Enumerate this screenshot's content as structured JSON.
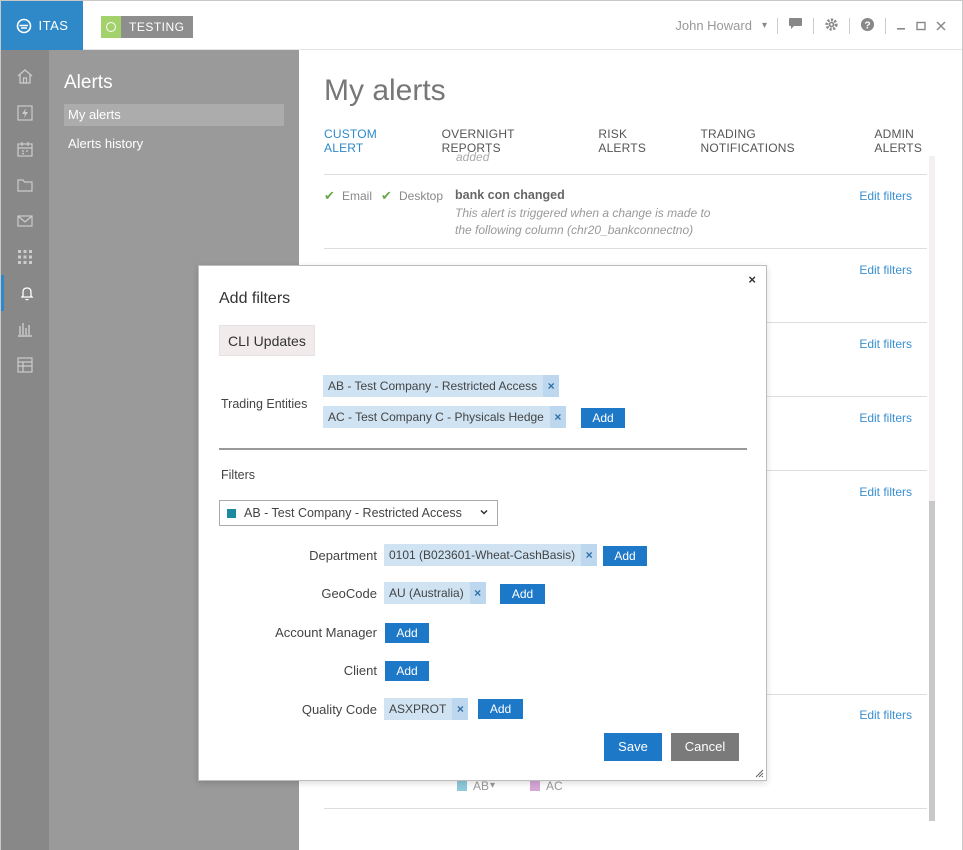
{
  "titlebar": {
    "logo_text": "ITAS",
    "env_badge": "TESTING",
    "user_name": "John Howard",
    "user_caret": "▾",
    "icons": [
      "chat-icon",
      "gear-icon",
      "help-icon",
      "minimize-icon",
      "maximize-icon",
      "close-icon"
    ]
  },
  "iconbar": {
    "items": [
      "home-icon",
      "lightning-icon",
      "calendar-icon",
      "folder-icon",
      "mail-icon",
      "grid-icon",
      "bell-icon",
      "bar-chart-icon",
      "table-icon"
    ],
    "active": "bell-icon"
  },
  "sidebar": {
    "title": "Alerts",
    "items": [
      {
        "label": "My alerts",
        "selected": true
      },
      {
        "label": "Alerts history",
        "selected": false
      }
    ]
  },
  "main": {
    "title": "My alerts",
    "tabs": [
      {
        "label": "CUSTOM ALERT",
        "active": true
      },
      {
        "label": "OVERNIGHT REPORTS",
        "active": false
      },
      {
        "label": "RISK ALERTS",
        "active": false
      },
      {
        "label": "TRADING NOTIFICATIONS",
        "active": false
      },
      {
        "label": "ADMIN ALERTS",
        "active": false
      }
    ],
    "clipped_text": "added",
    "alert": {
      "email_label": "Email",
      "desktop_label": "Desktop",
      "name": "bank con changed",
      "description_line1": "This alert is triggered when a change is made to",
      "description_line2": "the following column  (chr20_bankconnectno)"
    },
    "edit_filters_label": "Edit filters",
    "legend": [
      {
        "label": "AB",
        "color": "#8ec9dc",
        "caret": "▾"
      },
      {
        "label": "AC",
        "color": "#d6a6d6"
      }
    ]
  },
  "dialog": {
    "title": "Add filters",
    "close_symbol": "×",
    "group_label": "CLI Updates",
    "trading_entities_label": "Trading Entities",
    "trading_entities": [
      "AB - Test Company - Restricted Access",
      "AC - Test Company C - Physicals Hedge"
    ],
    "filters_label": "Filters",
    "selected_entity": "AB - Test Company - Restricted Access",
    "remove_symbol": "×",
    "add_label": "Add",
    "fields": {
      "department": {
        "label": "Department",
        "chips": [
          "0101 (B023601-Wheat-CashBasis)"
        ]
      },
      "geocode": {
        "label": "GeoCode",
        "chips": [
          "AU  (Australia)"
        ]
      },
      "account_manager": {
        "label": "Account Manager",
        "chips": []
      },
      "client": {
        "label": "Client",
        "chips": []
      },
      "quality_code": {
        "label": "Quality Code",
        "chips": [
          "ASXPROT"
        ]
      }
    },
    "save_label": "Save",
    "cancel_label": "Cancel"
  },
  "colors": {
    "accent": "#2f89c9",
    "button_blue": "#1e78c8",
    "chip_bg": "#cfe3f3",
    "sidebar_bg": "#9a9a9a",
    "iconbar_bg": "#888888",
    "env_badge_green": "#a3d16c",
    "check_green": "#6aa84f"
  }
}
